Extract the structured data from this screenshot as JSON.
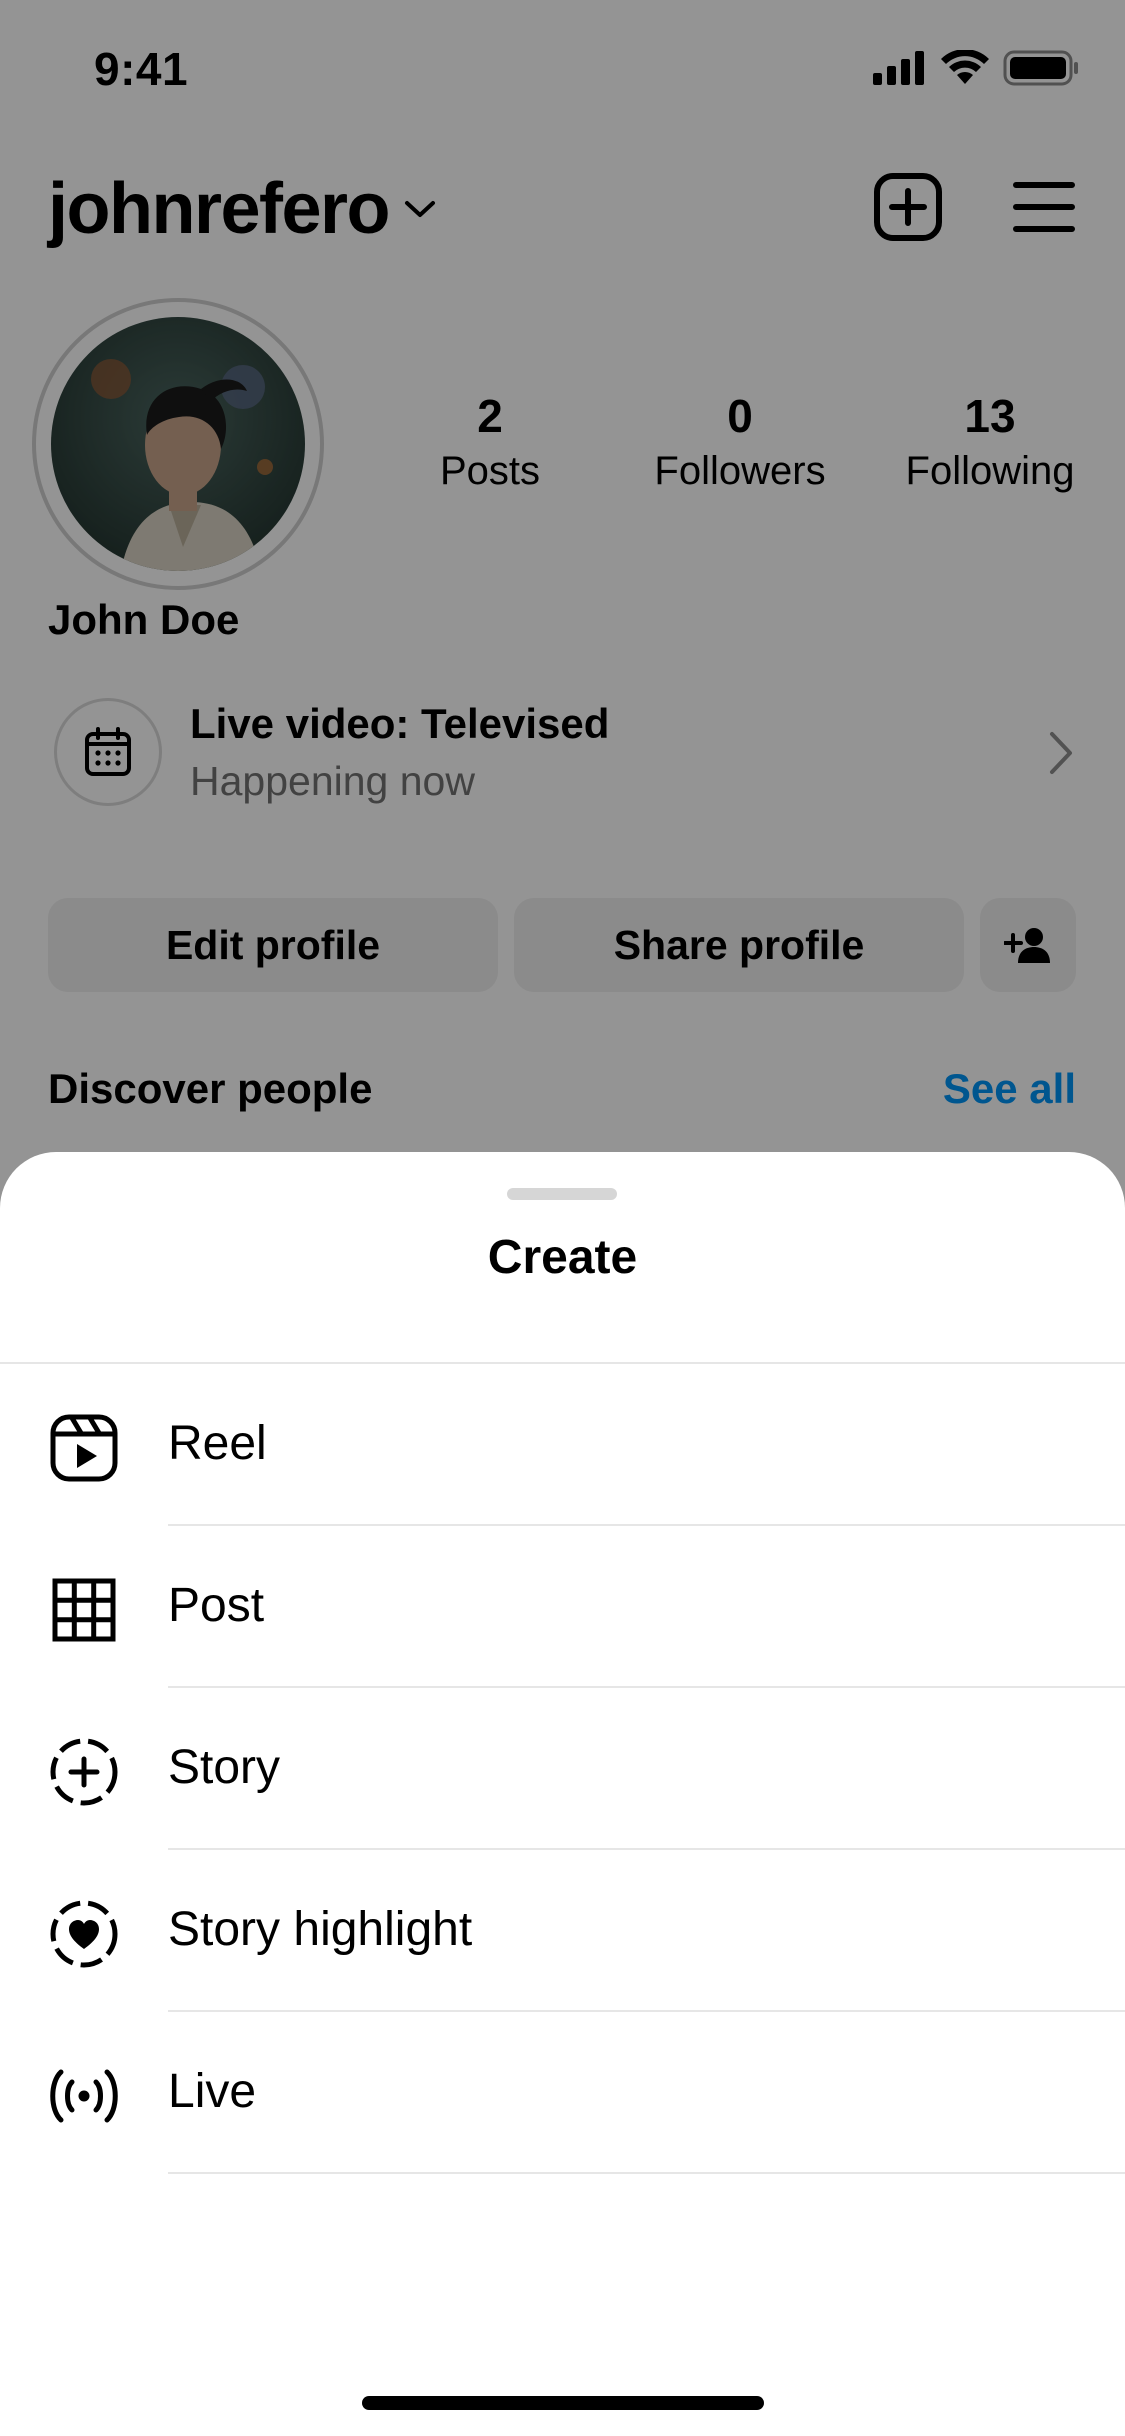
{
  "status_bar": {
    "time": "9:41"
  },
  "profile": {
    "username": "johnrefero",
    "display_name": "John Doe",
    "stats": [
      {
        "count": "2",
        "label": "Posts"
      },
      {
        "count": "0",
        "label": "Followers"
      },
      {
        "count": "13",
        "label": "Following"
      }
    ],
    "live": {
      "title": "Live video: Televised",
      "subtitle": "Happening now"
    },
    "buttons": {
      "edit": "Edit profile",
      "share": "Share profile"
    },
    "discover": {
      "title": "Discover people",
      "see_all": "See all"
    }
  },
  "colors": {
    "accent": "#0095f6",
    "overlay": "rgba(0,0,0,0.42)"
  },
  "sheet": {
    "title": "Create",
    "items": [
      {
        "label": "Reel",
        "icon": "reel-icon"
      },
      {
        "label": "Post",
        "icon": "grid-icon"
      },
      {
        "label": "Story",
        "icon": "story-add-icon"
      },
      {
        "label": "Story highlight",
        "icon": "story-highlight-icon"
      },
      {
        "label": "Live",
        "icon": "live-icon"
      }
    ]
  }
}
